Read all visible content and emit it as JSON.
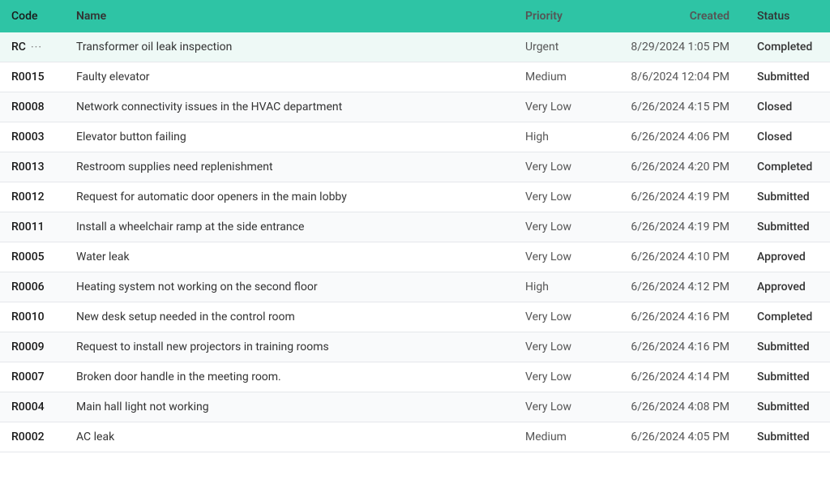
{
  "table": {
    "headers": {
      "code": "Code",
      "name": "Name",
      "priority": "Priority",
      "created": "Created",
      "status": "Status"
    },
    "rows": [
      {
        "code": "RC",
        "extra_icon": "···",
        "name": "Transformer oil leak inspection",
        "priority": "Urgent",
        "created": "8/29/2024 1:05 PM",
        "status": "Completed",
        "is_rc": true
      },
      {
        "code": "R0015",
        "name": "Faulty elevator",
        "priority": "Medium",
        "created": "8/6/2024 12:04 PM",
        "status": "Submitted",
        "is_rc": false
      },
      {
        "code": "R0008",
        "name": "Network connectivity issues in the HVAC department",
        "priority": "Very Low",
        "created": "6/26/2024 4:15 PM",
        "status": "Closed",
        "is_rc": false
      },
      {
        "code": "R0003",
        "name": "Elevator button failing",
        "priority": "High",
        "created": "6/26/2024 4:06 PM",
        "status": "Closed",
        "is_rc": false
      },
      {
        "code": "R0013",
        "name": "Restroom supplies need replenishment",
        "priority": "Very Low",
        "created": "6/26/2024 4:20 PM",
        "status": "Completed",
        "is_rc": false
      },
      {
        "code": "R0012",
        "name": "Request for automatic door openers in the main lobby",
        "priority": "Very Low",
        "created": "6/26/2024 4:19 PM",
        "status": "Submitted",
        "is_rc": false
      },
      {
        "code": "R0011",
        "name": "Install a wheelchair ramp at the side entrance",
        "priority": "Very Low",
        "created": "6/26/2024 4:19 PM",
        "status": "Submitted",
        "is_rc": false
      },
      {
        "code": "R0005",
        "name": "Water leak",
        "priority": "Very Low",
        "created": "6/26/2024 4:10 PM",
        "status": "Approved",
        "is_rc": false
      },
      {
        "code": "R0006",
        "name": "Heating system not working on the second floor",
        "priority": "High",
        "created": "6/26/2024 4:12 PM",
        "status": "Approved",
        "is_rc": false
      },
      {
        "code": "R0010",
        "name": "New desk setup needed in the control room",
        "priority": "Very Low",
        "created": "6/26/2024 4:16 PM",
        "status": "Completed",
        "is_rc": false
      },
      {
        "code": "R0009",
        "name": "Request to install new projectors in training rooms",
        "priority": "Very Low",
        "created": "6/26/2024 4:16 PM",
        "status": "Submitted",
        "is_rc": false
      },
      {
        "code": "R0007",
        "name": "Broken door handle in the meeting room.",
        "priority": "Very Low",
        "created": "6/26/2024 4:14 PM",
        "status": "Submitted",
        "is_rc": false
      },
      {
        "code": "R0004",
        "name": "Main hall light not working",
        "priority": "Very Low",
        "created": "6/26/2024 4:08 PM",
        "status": "Submitted",
        "is_rc": false
      },
      {
        "code": "R0002",
        "name": "AC leak",
        "priority": "Medium",
        "created": "6/26/2024 4:05 PM",
        "status": "Submitted",
        "is_rc": false
      }
    ]
  }
}
